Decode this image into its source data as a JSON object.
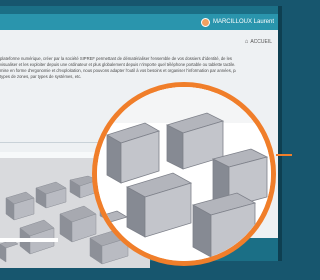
{
  "header": {
    "username": "MARCILLOUX Laurent"
  },
  "breadcrumb": {
    "home_label": "ACCUEIL"
  },
  "intro": {
    "lines": [
      "plateforme numérique, créer par la société SIPREF permettant de dématérialiser l'ensemble de vos dossiers d'identité, de les",
      "visualiser et les exploiter depuis une ordinateur et plus globalement depuis n'importe quel téléphone portable ou tablette tactile.",
      "mise en forme d'ergonomie et d'exploitation, nous pouvons adapter l'outil à vos besoins et organiser l'information par années, par",
      "types de zones, par types de systèmes, etc."
    ]
  },
  "colors": {
    "topbar": "#2a95ad",
    "frame": "#17566e",
    "lens_border": "#f07e2a",
    "content_bg": "#eef1f3"
  },
  "icons": {
    "home": "home-icon",
    "user": "avatar-icon"
  }
}
